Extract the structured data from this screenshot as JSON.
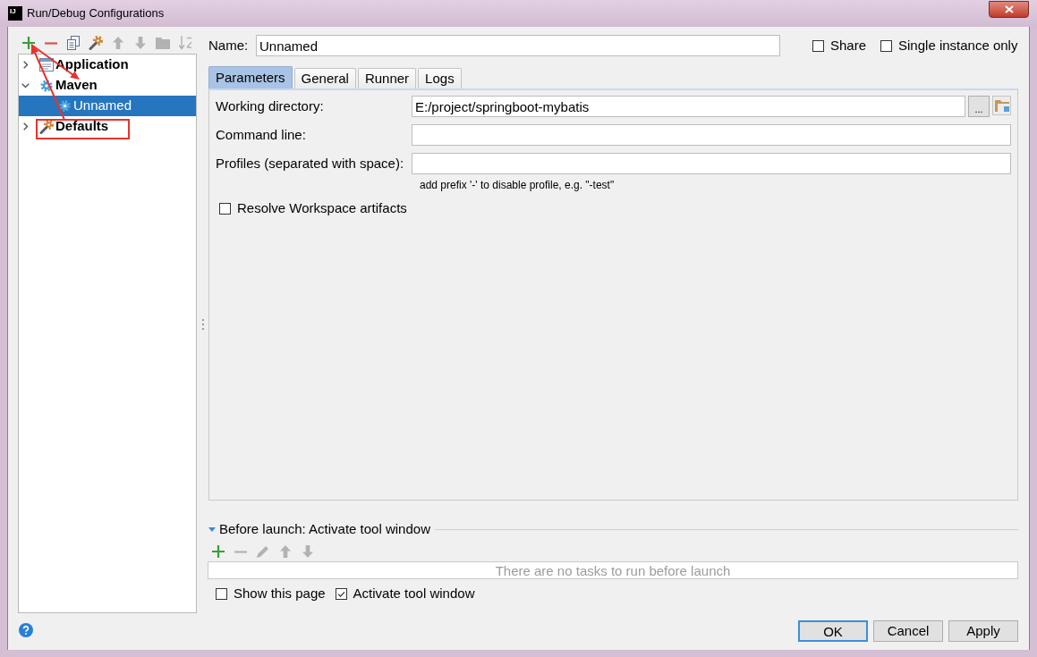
{
  "window": {
    "icon_text": "IJ",
    "title": "Run/Debug Configurations"
  },
  "toolbar": [
    {
      "kind": "add",
      "disabled": false
    },
    {
      "kind": "remove",
      "disabled": false
    },
    {
      "kind": "copy",
      "disabled": false
    },
    {
      "kind": "wrench",
      "disabled": false
    },
    {
      "kind": "move-up",
      "disabled": true
    },
    {
      "kind": "move-down",
      "disabled": true
    },
    {
      "kind": "folder",
      "disabled": true
    },
    {
      "kind": "sort",
      "disabled": true
    }
  ],
  "tree": [
    {
      "label": "Application",
      "kind": "application",
      "expanded": false,
      "selected": false
    },
    {
      "label": "Maven",
      "kind": "maven",
      "expanded": true,
      "selected": false,
      "children": [
        {
          "label": "Unnamed",
          "kind": "configuration",
          "selected": true
        }
      ]
    },
    {
      "label": "Defaults",
      "kind": "defaults",
      "expanded": false,
      "selected": false
    }
  ],
  "name_field": {
    "label": "Name:",
    "value": "Unnamed"
  },
  "options": [
    {
      "label": "Share",
      "checked": false
    },
    {
      "label": "Single instance only",
      "checked": false
    }
  ],
  "tabs": [
    {
      "label": "Parameters",
      "selected": true
    },
    {
      "label": "General",
      "selected": false
    },
    {
      "label": "Runner",
      "selected": false
    },
    {
      "label": "Logs",
      "selected": false
    }
  ],
  "parameters": {
    "fields": [
      {
        "kind": "path",
        "label": "Working directory:",
        "value": "E:/project/springboot-mybatis",
        "browse_label": "..."
      },
      {
        "kind": "text",
        "label": "Command line:"
      },
      {
        "kind": "text",
        "label": "Profiles (separated with space):",
        "hint": "add prefix '-' to disable profile, e.g. \"-test\""
      }
    ],
    "checkboxes": [
      {
        "label": "Resolve Workspace artifacts",
        "checked": false
      }
    ]
  },
  "before_launch": {
    "title": "Before launch: Activate tool window",
    "expanded": true,
    "toolbar": [
      {
        "kind": "add",
        "disabled": false
      },
      {
        "kind": "remove",
        "disabled": true
      },
      {
        "kind": "edit",
        "disabled": true
      },
      {
        "kind": "move-up",
        "disabled": true
      },
      {
        "kind": "move-down",
        "disabled": true
      }
    ],
    "empty_text": "There are no tasks to run before launch",
    "checkboxes": [
      {
        "label": "Show this page",
        "checked": false
      },
      {
        "label": "Activate tool window",
        "checked": true
      }
    ]
  },
  "buttons": [
    {
      "label": "OK",
      "default": true
    },
    {
      "label": "Cancel",
      "default": false
    },
    {
      "label": "Apply",
      "default": false
    }
  ]
}
